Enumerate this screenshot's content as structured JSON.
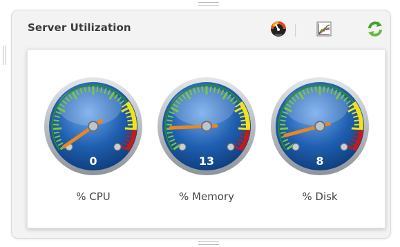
{
  "widget": {
    "title": "Server Utilization",
    "icons": {
      "speedometer": "speedometer-icon",
      "chart": "line-chart-icon",
      "refresh": "refresh-icon"
    }
  },
  "gauges": [
    {
      "id": "cpu",
      "label": "% CPU",
      "value": 0,
      "display": "0"
    },
    {
      "id": "memory",
      "label": "% Memory",
      "value": 13,
      "display": "13"
    },
    {
      "id": "disk",
      "label": "% Disk",
      "value": 8,
      "display": "8"
    }
  ],
  "gauge_scale": {
    "min": 0,
    "max": 100
  },
  "colors": {
    "dial_blue": "#1f5fb0",
    "needle": "#e8881e",
    "zone_green": "#7cc93a",
    "zone_yellow": "#f2e21a",
    "zone_red": "#c01c1c",
    "value_text": "#ffffff"
  }
}
